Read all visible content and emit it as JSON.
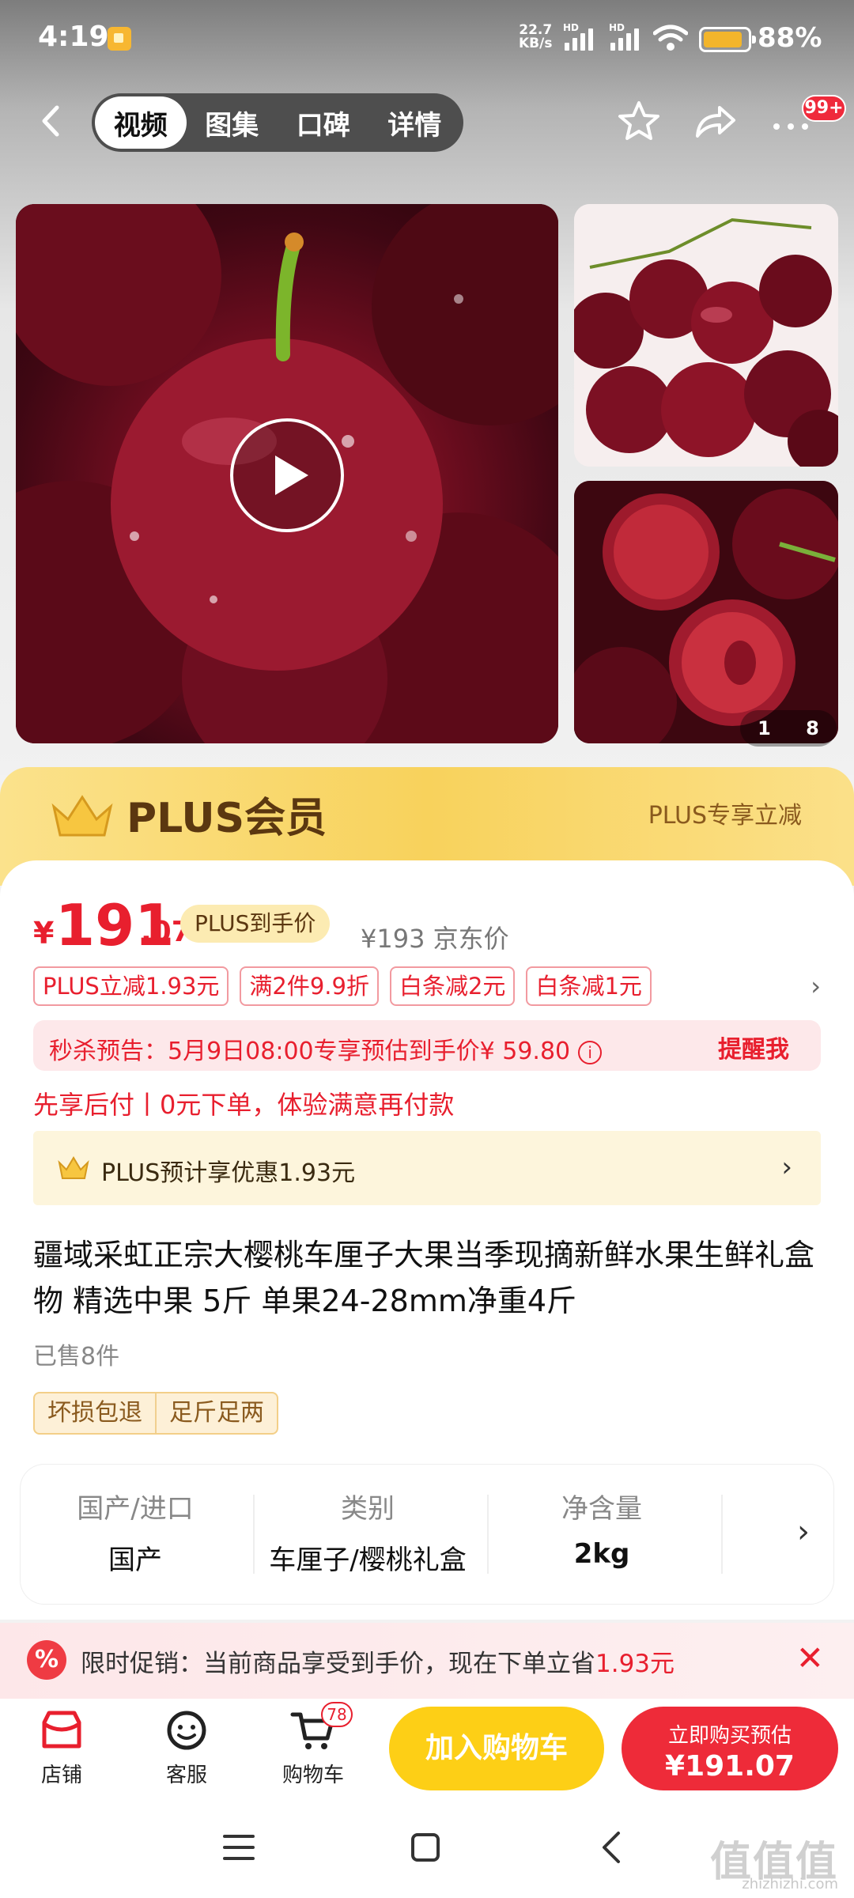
{
  "status": {
    "time": "4:19",
    "speed_line1": "22.7",
    "speed_line2": "KB/s",
    "hd": "HD",
    "battery_pct": "88%",
    "battery_level": 0.88
  },
  "nav": {
    "tabs": [
      {
        "label": "视频",
        "active": true
      },
      {
        "label": "图集"
      },
      {
        "label": "口碑"
      },
      {
        "label": "详情"
      }
    ],
    "cart_badge": "99+"
  },
  "gallery": {
    "current": "1",
    "total": "8"
  },
  "plus": {
    "title": "PLUS会员",
    "right": "PLUS专享立减"
  },
  "price": {
    "yen": "¥",
    "integer": "191",
    "decimal": ".07",
    "tag": "PLUS到手价",
    "jd_price": "¥193 京东价"
  },
  "coupons": [
    "PLUS立减1.93元",
    "满2件9.9折",
    "白条减2元",
    "白条减1元"
  ],
  "flash_sale": {
    "text": "秒杀预告：5月9日08:00专享预估到手价¥ 59.80",
    "info": "i",
    "remind": "提醒我"
  },
  "pay_later": "先享后付丨0元下单，体验满意再付款",
  "plus_save": {
    "text": "PLUS预计享优惠1.93元"
  },
  "title": "疆域采虹正宗大樱桃车厘子大果当季现摘新鲜水果生鲜礼盒物 精选中果 5斤 单果24-28mm净重4斤",
  "sold": "已售8件",
  "badges": [
    "坏损包退",
    "足斤足两"
  ],
  "specs": [
    {
      "label": "国产/进口",
      "value": "国产"
    },
    {
      "label": "类别",
      "value": "车厘子/樱桃礼盒"
    },
    {
      "label": "净含量",
      "value": "2kg"
    }
  ],
  "promo": {
    "text_prefix": "限时促销：当前商品享受到手价，现在下单立省",
    "amount": "1.93元",
    "close": "✕"
  },
  "bottom": {
    "store": "店铺",
    "service": "客服",
    "cart": "购物车",
    "cart_count": "78",
    "add_cart": "加入购物车",
    "buy_line1": "立即购买预估",
    "buy_line2": "¥191.07"
  },
  "watermark": {
    "main": "值值值",
    "sub": "zhizhizhi.com"
  },
  "colors": {
    "accent": "#e81f2e",
    "cart_button": "#fdcf16",
    "buy_button": "#ee2b39",
    "plus_gold": "#f8d25c"
  }
}
